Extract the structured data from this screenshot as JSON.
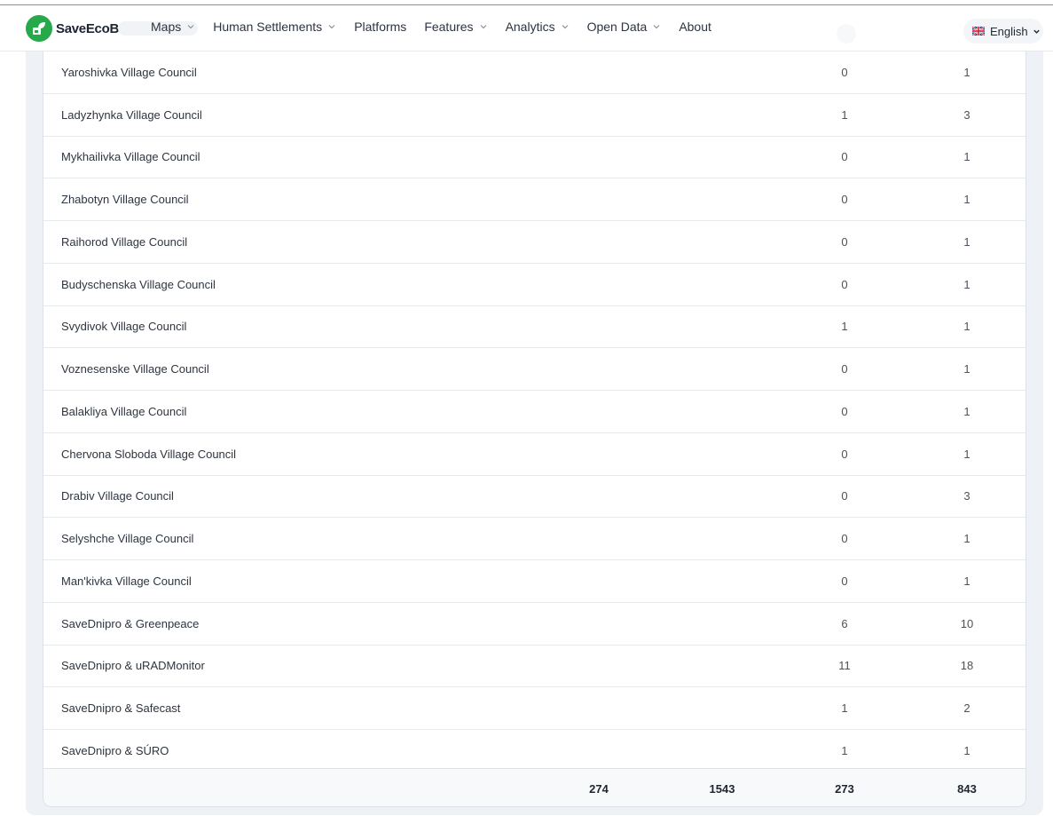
{
  "brand": {
    "name": "SaveEcoBot",
    "accent": "#27a84a"
  },
  "nav": {
    "items": [
      {
        "label": "Maps",
        "dropdown": true
      },
      {
        "label": "Human Settlements",
        "dropdown": true
      },
      {
        "label": "Platforms",
        "dropdown": false
      },
      {
        "label": "Features",
        "dropdown": true
      },
      {
        "label": "Analytics",
        "dropdown": true
      },
      {
        "label": "Open Data",
        "dropdown": true
      },
      {
        "label": "About",
        "dropdown": false
      }
    ],
    "language": "English"
  },
  "table": {
    "rows": [
      {
        "name": "Yaroshivka Village Council",
        "col3": "0",
        "col4": "1"
      },
      {
        "name": "Ladyzhynka Village Council",
        "col3": "1",
        "col4": "3"
      },
      {
        "name": "Mykhailivka Village Council",
        "col3": "0",
        "col4": "1"
      },
      {
        "name": "Zhabotyn Village Council",
        "col3": "0",
        "col4": "1"
      },
      {
        "name": "Raihorod Village Council",
        "col3": "0",
        "col4": "1"
      },
      {
        "name": "Budyschenska Village Council",
        "col3": "0",
        "col4": "1"
      },
      {
        "name": "Svydivok Village Council",
        "col3": "1",
        "col4": "1"
      },
      {
        "name": "Voznesenske Village Council",
        "col3": "0",
        "col4": "1"
      },
      {
        "name": "Balakliya Village Council",
        "col3": "0",
        "col4": "1"
      },
      {
        "name": "Chervona Sloboda Village Council",
        "col3": "0",
        "col4": "1"
      },
      {
        "name": "Drabiv Village Council",
        "col3": "0",
        "col4": "3"
      },
      {
        "name": "Selyshche Village Council",
        "col3": "0",
        "col4": "1"
      },
      {
        "name": "Man'kivka Village Council",
        "col3": "0",
        "col4": "1"
      },
      {
        "name": "SaveDnipro & Greenpeace",
        "col3": "6",
        "col4": "10"
      },
      {
        "name": "SaveDnipro & uRADMonitor",
        "col3": "11",
        "col4": "18"
      },
      {
        "name": "SaveDnipro & Safecast",
        "col3": "1",
        "col4": "2"
      },
      {
        "name": "SaveDnipro & SÚRO",
        "col3": "1",
        "col4": "1"
      }
    ],
    "totals": {
      "col1": "274",
      "col2": "1543",
      "col3": "273",
      "col4": "843"
    }
  }
}
